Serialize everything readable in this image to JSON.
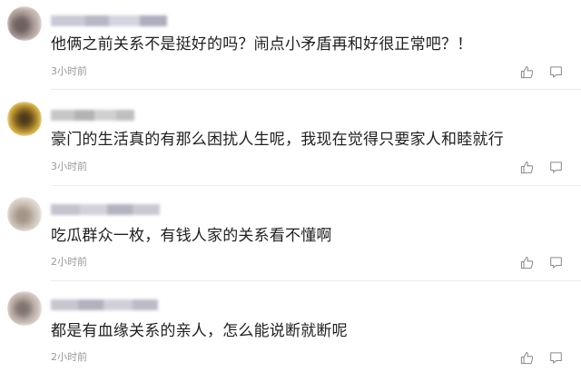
{
  "comments": [
    {
      "text": "他俩之前关系不是挺好的吗？闹点小矛盾再和好很正常吧？！",
      "time": "3小时前",
      "avatar_colors": [
        "#d7c8c4",
        "#a99a96",
        "#6e6260"
      ],
      "username_colors": [
        "#c9c9d6",
        "#b7b7c6",
        "#d4d4df",
        "#aeaebe"
      ]
    },
    {
      "text": "豪门的生活真的有那么困扰人生呢，我现在觉得只要家人和睦就行",
      "time": "3小时前",
      "avatar_colors": [
        "#e7c04a",
        "#8d6a1f",
        "#4a3a1c"
      ],
      "username_colors": [
        "#c7c7c7",
        "#b3b3b3",
        "#d0d0d0",
        "#bfbfbf"
      ]
    },
    {
      "text": "吃瓜群众一枚，有钱人家的关系看不懂啊",
      "time": "2小时前",
      "avatar_colors": [
        "#e9e3dc",
        "#c9bfb4",
        "#a39588"
      ],
      "username_colors": [
        "#c4c4ce",
        "#d2d2da",
        "#b4b4c0",
        "#c9c9d2"
      ]
    },
    {
      "text": "都是有血缘关系的亲人，怎么能说断就断呢",
      "time": "2小时前",
      "avatar_colors": [
        "#e0d5d0",
        "#b9aaa4",
        "#7f7470"
      ],
      "username_colors": [
        "#c6c6cf",
        "#b2b2bd",
        "#cfcfd8",
        "#bcbcc6"
      ]
    }
  ],
  "icons": {
    "like": "thumbs-up-icon",
    "reply": "comment-icon"
  }
}
